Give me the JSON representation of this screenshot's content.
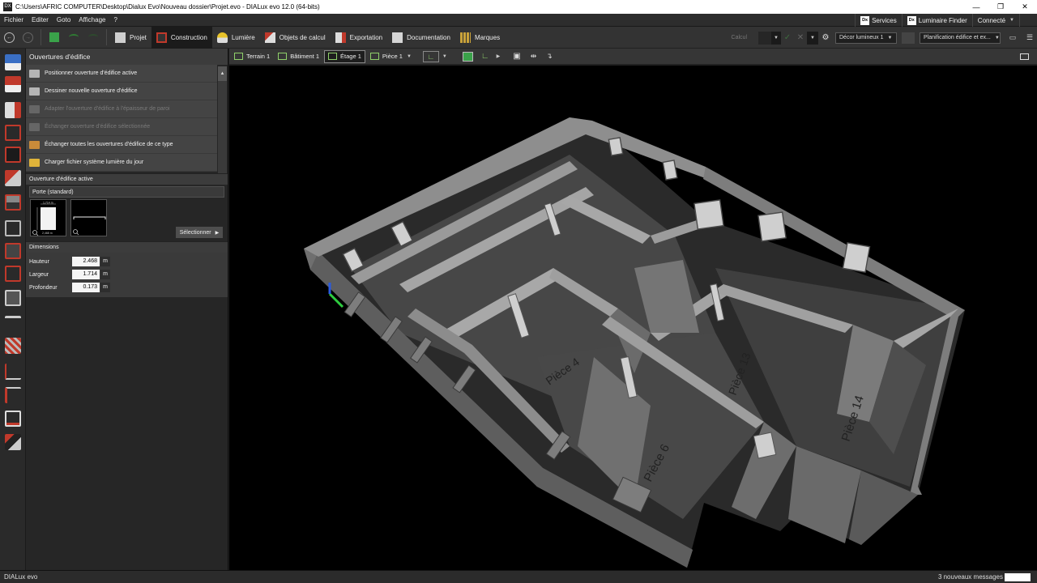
{
  "window": {
    "title": "C:\\Users\\AFRIC COMPUTER\\Desktop\\Dialux Evo\\Nouveau dossier\\Projet.evo - DIALux evo 12.0  (64-bits)",
    "app_badge": "DX",
    "controls": [
      "minimize-icon",
      "maximize-icon",
      "close-icon"
    ]
  },
  "menubar": {
    "items": [
      "Fichier",
      "Editer",
      "Goto",
      "Affichage",
      "?"
    ],
    "services": "Services",
    "luminaire_finder": "Luminaire Finder",
    "connected": "Connecté",
    "badge": "Dx"
  },
  "toolbar": {
    "tabs": [
      {
        "label": "Projet",
        "icon": "project-icon"
      },
      {
        "label": "Construction",
        "icon": "construction-icon",
        "active": true
      },
      {
        "label": "Lumière",
        "icon": "light-icon"
      },
      {
        "label": "Objets de calcul",
        "icon": "calc-objects-icon"
      },
      {
        "label": "Exportation",
        "icon": "export-icon"
      },
      {
        "label": "Documentation",
        "icon": "documentation-icon"
      },
      {
        "label": "Marques",
        "icon": "marks-icon"
      }
    ],
    "calcul": "Calcul",
    "scene": "Décor lumineux 1",
    "planning": "Planification édifice et ex...",
    "colors": {
      "active_bg": "#1b1b1b",
      "accent_red": "#c0392b",
      "accent_green": "#6ab04c"
    }
  },
  "panel": {
    "title": "Ouvertures d'édifice",
    "actions": [
      {
        "label": "Positionner ouverture d'édifice active",
        "enabled": true
      },
      {
        "label": "Dessiner nouvelle ouverture d'édifice",
        "enabled": true
      },
      {
        "label": "Adapter l'ouverture d'édifice à l'épaisseur de paroi",
        "enabled": false
      },
      {
        "label": "Échanger ouverture d'édifice sélectionnée",
        "enabled": false
      },
      {
        "label": "Échanger toutes les ouvertures d'édifice de ce type",
        "enabled": true
      },
      {
        "label": "Charger fichier système lumière du jour",
        "enabled": true
      }
    ],
    "active_section": "Ouverture d'édifice active",
    "active_type": "Porte (standard)",
    "select_button": "Sélectionner",
    "thumb_width_label": "1,714 m",
    "thumb_height_label": "2,468 m",
    "dimensions_title": "Dimensions",
    "dimensions": [
      {
        "label": "Hauteur",
        "value": "2.468",
        "unit": "m"
      },
      {
        "label": "Largeur",
        "value": "1.714",
        "unit": "m"
      },
      {
        "label": "Profondeur",
        "value": "0.173",
        "unit": "m"
      }
    ]
  },
  "viewport_toolbar": {
    "crumbs": [
      {
        "label": "Terrain 1"
      },
      {
        "label": "Bâtiment 1"
      },
      {
        "label": "Étage 1",
        "active": true
      },
      {
        "label": "Pièce 1"
      }
    ]
  },
  "viewport": {
    "room_labels": [
      "Pièce 4",
      "Pièce 6",
      "Pièce 13",
      "Pièce 14"
    ]
  },
  "status": {
    "left": "DIALux evo",
    "messages": "3 nouveaux messages"
  }
}
